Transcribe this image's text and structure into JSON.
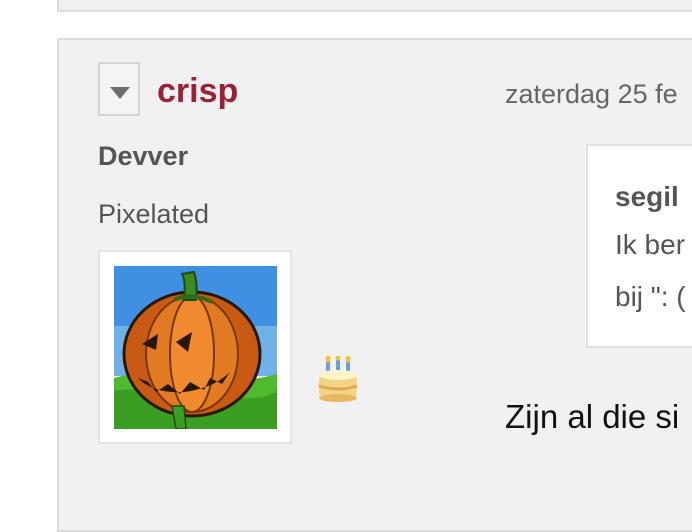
{
  "post": {
    "username": "crisp",
    "date": "zaterdag 25 fe",
    "user_title": "Devver",
    "user_subtitle": "Pixelated",
    "avatar_icon": "pumpkin-avatar",
    "badge_icon": "birthday-cake-icon",
    "quote": {
      "author": "segil",
      "lines": [
        "Ik ber",
        "bij \": ("
      ]
    },
    "text": "Zijn al die si"
  },
  "colors": {
    "username": "#9b2137",
    "post_background": "#f1f1f1",
    "border": "#dcdcdc"
  }
}
